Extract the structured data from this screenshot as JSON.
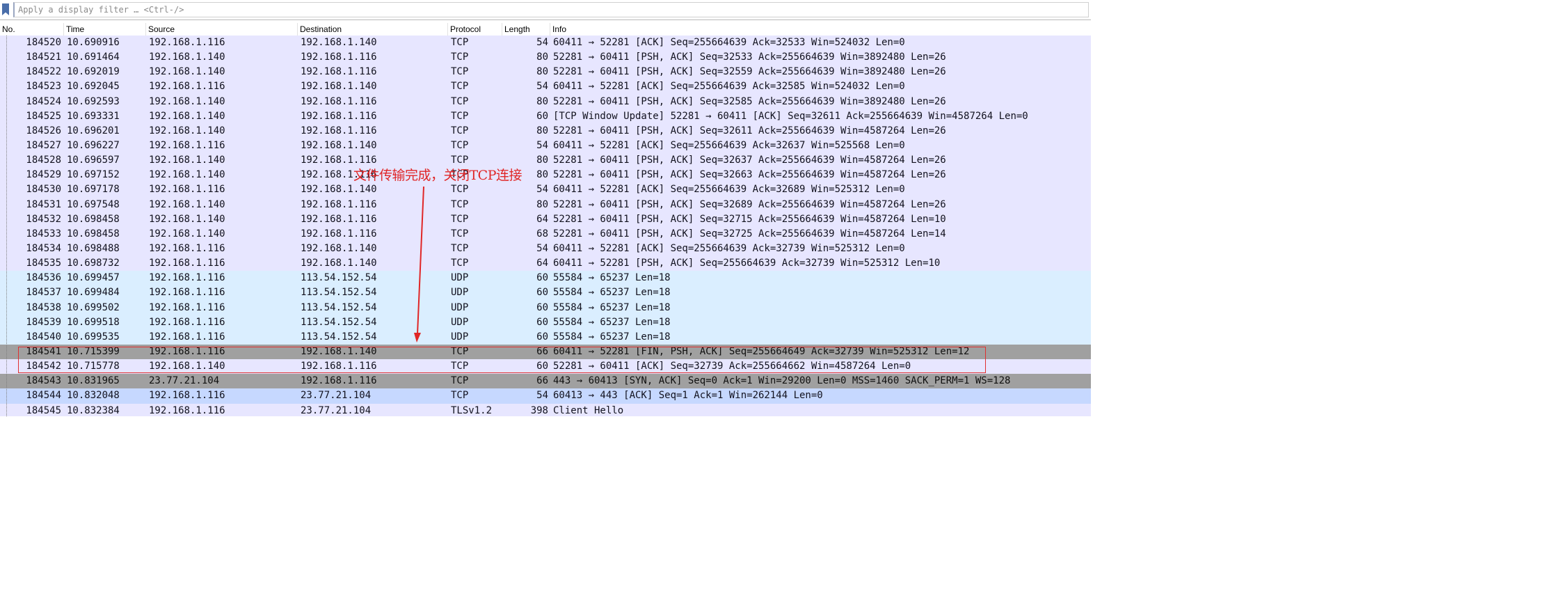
{
  "filter": {
    "placeholder": "Apply a display filter … <Ctrl-/>"
  },
  "columns": [
    "No.",
    "Time",
    "Source",
    "Destination",
    "Protocol",
    "Length",
    "Info"
  ],
  "colors": {
    "tcp_row": "#e7e6ff",
    "udp_row": "#daeeff",
    "dark_row": "#a0a0a0",
    "selected_row": "#c6d8ff",
    "annotation": "#e02626"
  },
  "annotation": {
    "text": "文件传输完成，关闭TCP连接"
  },
  "packets": [
    {
      "no": "184520",
      "time": "10.690916",
      "src": "192.168.1.116",
      "dst": "192.168.1.140",
      "proto": "TCP",
      "len": "54",
      "info": "60411 → 52281 [ACK] Seq=255664639 Ack=32533 Win=524032 Len=0",
      "style": "tcp"
    },
    {
      "no": "184521",
      "time": "10.691464",
      "src": "192.168.1.140",
      "dst": "192.168.1.116",
      "proto": "TCP",
      "len": "80",
      "info": "52281 → 60411 [PSH, ACK] Seq=32533 Ack=255664639 Win=3892480 Len=26",
      "style": "tcp"
    },
    {
      "no": "184522",
      "time": "10.692019",
      "src": "192.168.1.140",
      "dst": "192.168.1.116",
      "proto": "TCP",
      "len": "80",
      "info": "52281 → 60411 [PSH, ACK] Seq=32559 Ack=255664639 Win=3892480 Len=26",
      "style": "tcp"
    },
    {
      "no": "184523",
      "time": "10.692045",
      "src": "192.168.1.116",
      "dst": "192.168.1.140",
      "proto": "TCP",
      "len": "54",
      "info": "60411 → 52281 [ACK] Seq=255664639 Ack=32585 Win=524032 Len=0",
      "style": "tcp"
    },
    {
      "no": "184524",
      "time": "10.692593",
      "src": "192.168.1.140",
      "dst": "192.168.1.116",
      "proto": "TCP",
      "len": "80",
      "info": "52281 → 60411 [PSH, ACK] Seq=32585 Ack=255664639 Win=3892480 Len=26",
      "style": "tcp"
    },
    {
      "no": "184525",
      "time": "10.693331",
      "src": "192.168.1.140",
      "dst": "192.168.1.116",
      "proto": "TCP",
      "len": "60",
      "info": "[TCP Window Update] 52281 → 60411 [ACK] Seq=32611 Ack=255664639 Win=4587264 Len=0",
      "style": "tcp"
    },
    {
      "no": "184526",
      "time": "10.696201",
      "src": "192.168.1.140",
      "dst": "192.168.1.116",
      "proto": "TCP",
      "len": "80",
      "info": "52281 → 60411 [PSH, ACK] Seq=32611 Ack=255664639 Win=4587264 Len=26",
      "style": "tcp"
    },
    {
      "no": "184527",
      "time": "10.696227",
      "src": "192.168.1.116",
      "dst": "192.168.1.140",
      "proto": "TCP",
      "len": "54",
      "info": "60411 → 52281 [ACK] Seq=255664639 Ack=32637 Win=525568 Len=0",
      "style": "tcp"
    },
    {
      "no": "184528",
      "time": "10.696597",
      "src": "192.168.1.140",
      "dst": "192.168.1.116",
      "proto": "TCP",
      "len": "80",
      "info": "52281 → 60411 [PSH, ACK] Seq=32637 Ack=255664639 Win=4587264 Len=26",
      "style": "tcp"
    },
    {
      "no": "184529",
      "time": "10.697152",
      "src": "192.168.1.140",
      "dst": "192.168.1.116",
      "proto": "TCP",
      "len": "80",
      "info": "52281 → 60411 [PSH, ACK] Seq=32663 Ack=255664639 Win=4587264 Len=26",
      "style": "tcp"
    },
    {
      "no": "184530",
      "time": "10.697178",
      "src": "192.168.1.116",
      "dst": "192.168.1.140",
      "proto": "TCP",
      "len": "54",
      "info": "60411 → 52281 [ACK] Seq=255664639 Ack=32689 Win=525312 Len=0",
      "style": "tcp"
    },
    {
      "no": "184531",
      "time": "10.697548",
      "src": "192.168.1.140",
      "dst": "192.168.1.116",
      "proto": "TCP",
      "len": "80",
      "info": "52281 → 60411 [PSH, ACK] Seq=32689 Ack=255664639 Win=4587264 Len=26",
      "style": "tcp"
    },
    {
      "no": "184532",
      "time": "10.698458",
      "src": "192.168.1.140",
      "dst": "192.168.1.116",
      "proto": "TCP",
      "len": "64",
      "info": "52281 → 60411 [PSH, ACK] Seq=32715 Ack=255664639 Win=4587264 Len=10",
      "style": "tcp"
    },
    {
      "no": "184533",
      "time": "10.698458",
      "src": "192.168.1.140",
      "dst": "192.168.1.116",
      "proto": "TCP",
      "len": "68",
      "info": "52281 → 60411 [PSH, ACK] Seq=32725 Ack=255664639 Win=4587264 Len=14",
      "style": "tcp"
    },
    {
      "no": "184534",
      "time": "10.698488",
      "src": "192.168.1.116",
      "dst": "192.168.1.140",
      "proto": "TCP",
      "len": "54",
      "info": "60411 → 52281 [ACK] Seq=255664639 Ack=32739 Win=525312 Len=0",
      "style": "tcp"
    },
    {
      "no": "184535",
      "time": "10.698732",
      "src": "192.168.1.116",
      "dst": "192.168.1.140",
      "proto": "TCP",
      "len": "64",
      "info": "60411 → 52281 [PSH, ACK] Seq=255664639 Ack=32739 Win=525312 Len=10",
      "style": "tcp"
    },
    {
      "no": "184536",
      "time": "10.699457",
      "src": "192.168.1.116",
      "dst": "113.54.152.54",
      "proto": "UDP",
      "len": "60",
      "info": "55584 → 65237 Len=18",
      "style": "udp"
    },
    {
      "no": "184537",
      "time": "10.699484",
      "src": "192.168.1.116",
      "dst": "113.54.152.54",
      "proto": "UDP",
      "len": "60",
      "info": "55584 → 65237 Len=18",
      "style": "udp"
    },
    {
      "no": "184538",
      "time": "10.699502",
      "src": "192.168.1.116",
      "dst": "113.54.152.54",
      "proto": "UDP",
      "len": "60",
      "info": "55584 → 65237 Len=18",
      "style": "udp"
    },
    {
      "no": "184539",
      "time": "10.699518",
      "src": "192.168.1.116",
      "dst": "113.54.152.54",
      "proto": "UDP",
      "len": "60",
      "info": "55584 → 65237 Len=18",
      "style": "udp"
    },
    {
      "no": "184540",
      "time": "10.699535",
      "src": "192.168.1.116",
      "dst": "113.54.152.54",
      "proto": "UDP",
      "len": "60",
      "info": "55584 → 65237 Len=18",
      "style": "udp"
    },
    {
      "no": "184541",
      "time": "10.715399",
      "src": "192.168.1.116",
      "dst": "192.168.1.140",
      "proto": "TCP",
      "len": "66",
      "info": "60411 → 52281 [FIN, PSH, ACK] Seq=255664649 Ack=32739 Win=525312 Len=12",
      "style": "dark"
    },
    {
      "no": "184542",
      "time": "10.715778",
      "src": "192.168.1.140",
      "dst": "192.168.1.116",
      "proto": "TCP",
      "len": "60",
      "info": "52281 → 60411 [ACK] Seq=32739 Ack=255664662 Win=4587264 Len=0",
      "style": "tcp"
    },
    {
      "no": "184543",
      "time": "10.831965",
      "src": "23.77.21.104",
      "dst": "192.168.1.116",
      "proto": "TCP",
      "len": "66",
      "info": "443 → 60413 [SYN, ACK] Seq=0 Ack=1 Win=29200 Len=0 MSS=1460 SACK_PERM=1 WS=128",
      "style": "dark"
    },
    {
      "no": "184544",
      "time": "10.832048",
      "src": "192.168.1.116",
      "dst": "23.77.21.104",
      "proto": "TCP",
      "len": "54",
      "info": "60413 → 443 [ACK] Seq=1 Ack=1 Win=262144 Len=0",
      "style": "sel"
    },
    {
      "no": "184545",
      "time": "10.832384",
      "src": "192.168.1.116",
      "dst": "23.77.21.104",
      "proto": "TLSv1.2",
      "len": "398",
      "info": "Client Hello",
      "style": "tcp"
    }
  ]
}
